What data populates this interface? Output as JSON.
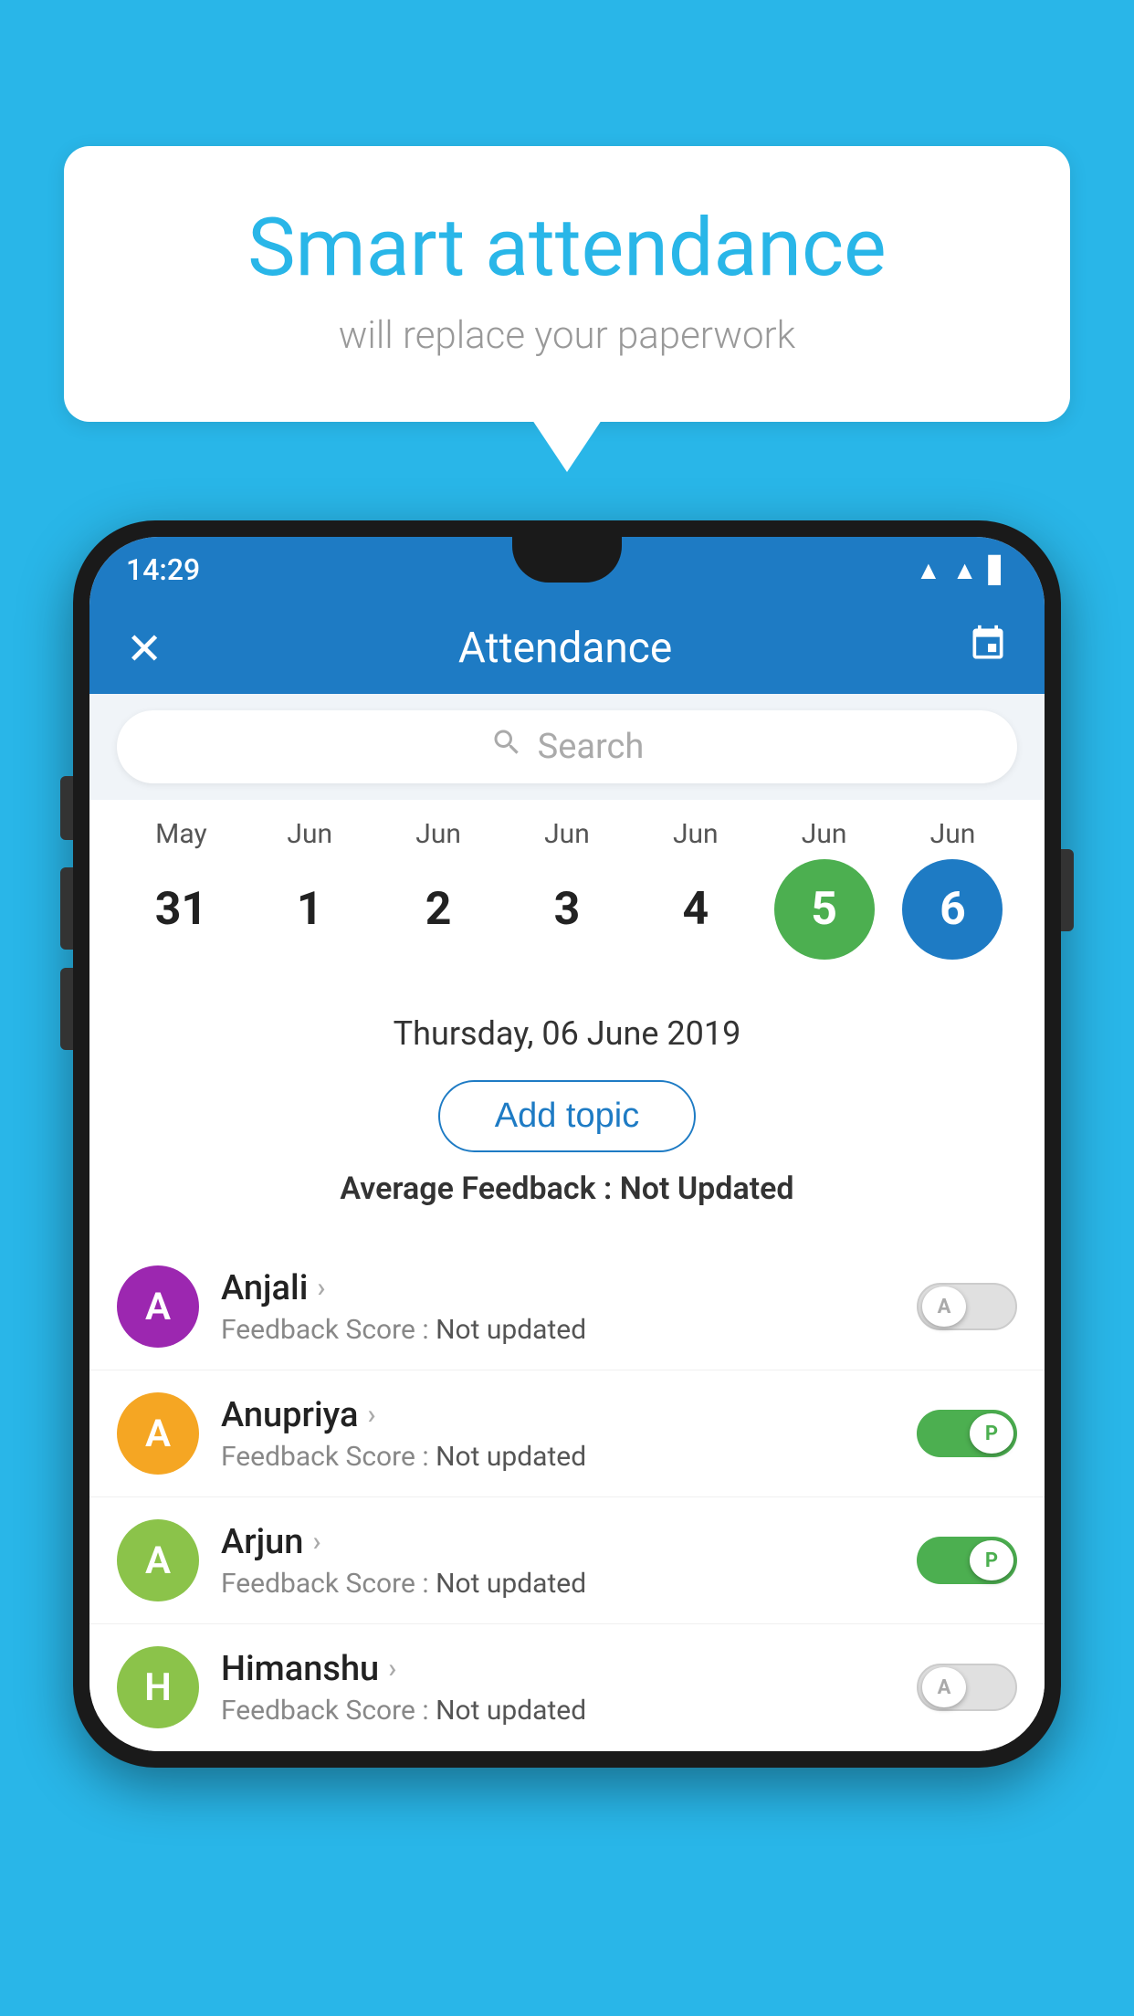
{
  "background_color": "#29b6e8",
  "bubble": {
    "title": "Smart attendance",
    "subtitle": "will replace your paperwork"
  },
  "status_bar": {
    "time": "14:29",
    "icons": [
      "wifi",
      "signal",
      "battery"
    ]
  },
  "header": {
    "close_label": "✕",
    "title": "Attendance",
    "calendar_icon": "📅"
  },
  "search": {
    "placeholder": "Search"
  },
  "calendar": {
    "months": [
      "May",
      "Jun",
      "Jun",
      "Jun",
      "Jun",
      "Jun",
      "Jun"
    ],
    "dates": [
      "31",
      "1",
      "2",
      "3",
      "4",
      "5",
      "6"
    ],
    "today_index": 5,
    "selected_index": 6
  },
  "selected_date_label": "Thursday, 06 June 2019",
  "add_topic_label": "Add topic",
  "avg_feedback_label": "Average Feedback :",
  "avg_feedback_value": "Not Updated",
  "students": [
    {
      "name": "Anjali",
      "avatar_letter": "A",
      "avatar_color": "#9c27b0",
      "feedback_label": "Feedback Score :",
      "feedback_value": "Not updated",
      "toggle_state": "off",
      "toggle_label": "A"
    },
    {
      "name": "Anupriya",
      "avatar_letter": "A",
      "avatar_color": "#f5a623",
      "feedback_label": "Feedback Score :",
      "feedback_value": "Not updated",
      "toggle_state": "on",
      "toggle_label": "P"
    },
    {
      "name": "Arjun",
      "avatar_letter": "A",
      "avatar_color": "#8bc34a",
      "feedback_label": "Feedback Score :",
      "feedback_value": "Not updated",
      "toggle_state": "on",
      "toggle_label": "P"
    },
    {
      "name": "Himanshu",
      "avatar_letter": "H",
      "avatar_color": "#8bc34a",
      "feedback_label": "Feedback Score :",
      "feedback_value": "Not updated",
      "toggle_state": "off",
      "toggle_label": "A"
    }
  ]
}
